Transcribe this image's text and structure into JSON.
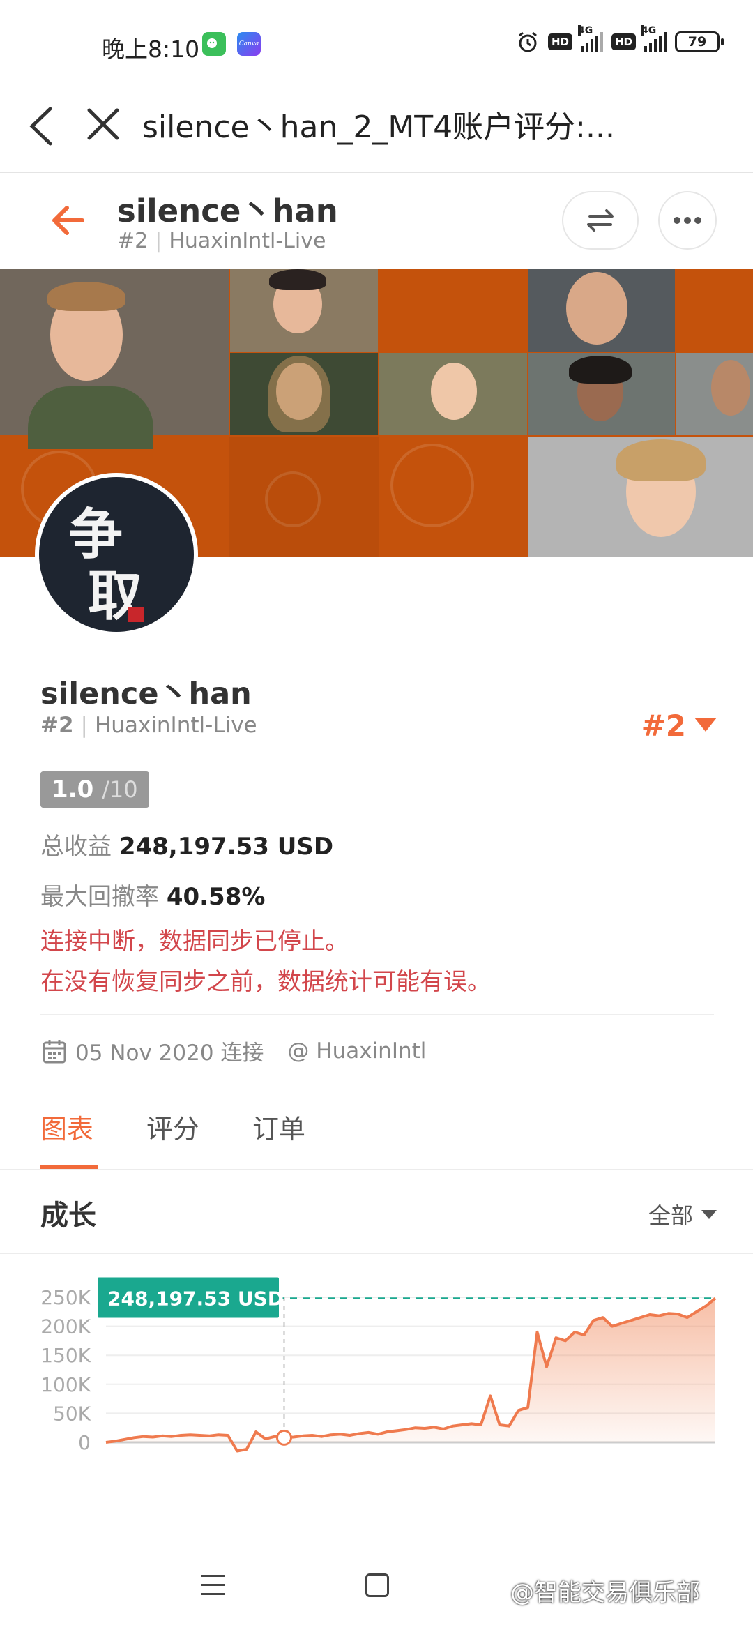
{
  "status_bar": {
    "time": "晚上8:10",
    "app2": "Canva",
    "hd1": "HD",
    "net1": "4G",
    "hd2": "HD",
    "net2": "4G",
    "battery": "79"
  },
  "title_bar": {
    "title": "silence丶han_2_MT4账户评分:..."
  },
  "header": {
    "name": "silence丶han",
    "rank": "#2",
    "server": "HuaxinIntl-Live"
  },
  "profile": {
    "name": "silence丶han",
    "rank": "#2",
    "server": "HuaxinIntl-Live",
    "rank_badge": "#2",
    "avatar_char1": "争",
    "avatar_char2": "取",
    "score_value": "1.0",
    "score_max": "/10",
    "total_profit_label": "总收益",
    "total_profit_value": "248,197.53 USD",
    "max_drawdown_label": "最大回撤率",
    "max_drawdown_value": "40.58%",
    "warning_line1": "连接中断，数据同步已停止。",
    "warning_line2": "在没有恢复同步之前，数据统计可能有误。",
    "connected_date": "05 Nov 2020 连接",
    "broker": "@ HuaxinIntl"
  },
  "tabs": [
    {
      "label": "图表",
      "active": true
    },
    {
      "label": "评分",
      "active": false
    },
    {
      "label": "订单",
      "active": false
    }
  ],
  "growth": {
    "title": "成长",
    "range": "全部"
  },
  "colors": {
    "accent": "#f26a3a",
    "warning": "#d2464b",
    "chart_line": "#ef7a4e",
    "value_tag": "#1aa88f"
  },
  "chart_data": {
    "type": "area",
    "y_ticks": [
      "250K",
      "200K",
      "150K",
      "100K",
      "50K",
      "0"
    ],
    "ylim": [
      0,
      250000
    ],
    "current_value_label": "248,197.53 USD",
    "current_value": 248197.53,
    "grid": true,
    "values": [
      0,
      2000,
      5000,
      8000,
      10000,
      9000,
      11000,
      10000,
      12000,
      13000,
      12000,
      11000,
      13000,
      12000,
      -15000,
      -12000,
      18000,
      6000,
      10000,
      8000,
      9000,
      11000,
      12000,
      10000,
      13000,
      14000,
      12000,
      15000,
      17000,
      14000,
      18000,
      20000,
      22000,
      25000,
      24000,
      26000,
      23000,
      28000,
      30000,
      32000,
      30000,
      80000,
      30000,
      28000,
      55000,
      60000,
      190000,
      130000,
      180000,
      175000,
      190000,
      185000,
      210000,
      215000,
      200000,
      205000,
      210000,
      215000,
      220000,
      218000,
      222000,
      221000,
      215000,
      225000,
      235000,
      248197.53
    ]
  },
  "nav": {
    "watermark": "@智能交易俱乐部"
  }
}
